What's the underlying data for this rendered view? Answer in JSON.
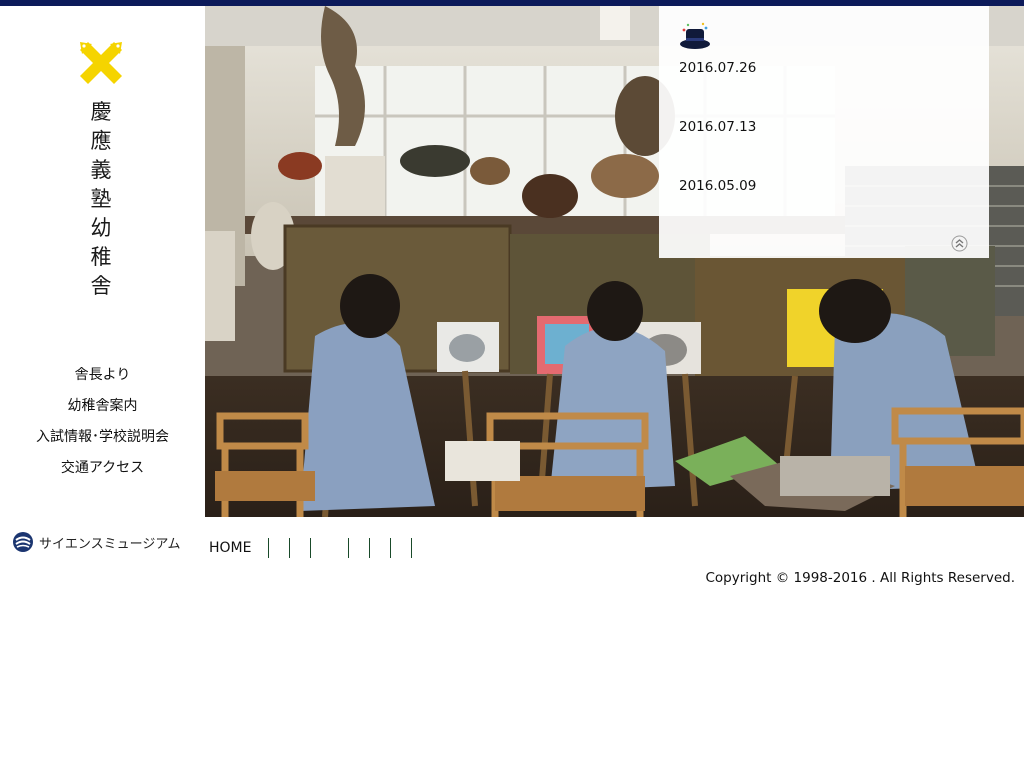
{
  "school": {
    "name_chars": [
      "慶",
      "應",
      "義",
      "塾",
      "幼",
      "稚",
      "舎"
    ]
  },
  "sidebar": {
    "items": [
      {
        "label": "舎長より"
      },
      {
        "label": "幼稚舎案内"
      },
      {
        "label": "入試情報･学校説明会"
      },
      {
        "label": "交通アクセス"
      }
    ],
    "museum_label": "サイエンスミュージアム"
  },
  "news": {
    "items": [
      {
        "date": "2016.07.26"
      },
      {
        "date": "2016.07.13"
      },
      {
        "date": "2016.05.09"
      }
    ]
  },
  "footer": {
    "home_label": "HOME",
    "copyright": "Copyright © 1998-2016 . All Rights Reserved."
  },
  "colors": {
    "top_bar": "#0c1a5a",
    "logo": "#f5d400",
    "museum_icon": "#1b3570"
  },
  "icons": {
    "logo": "crossed-pens-logo",
    "museum": "museum-icon",
    "scroll_top": "double-chevron-up-icon"
  }
}
